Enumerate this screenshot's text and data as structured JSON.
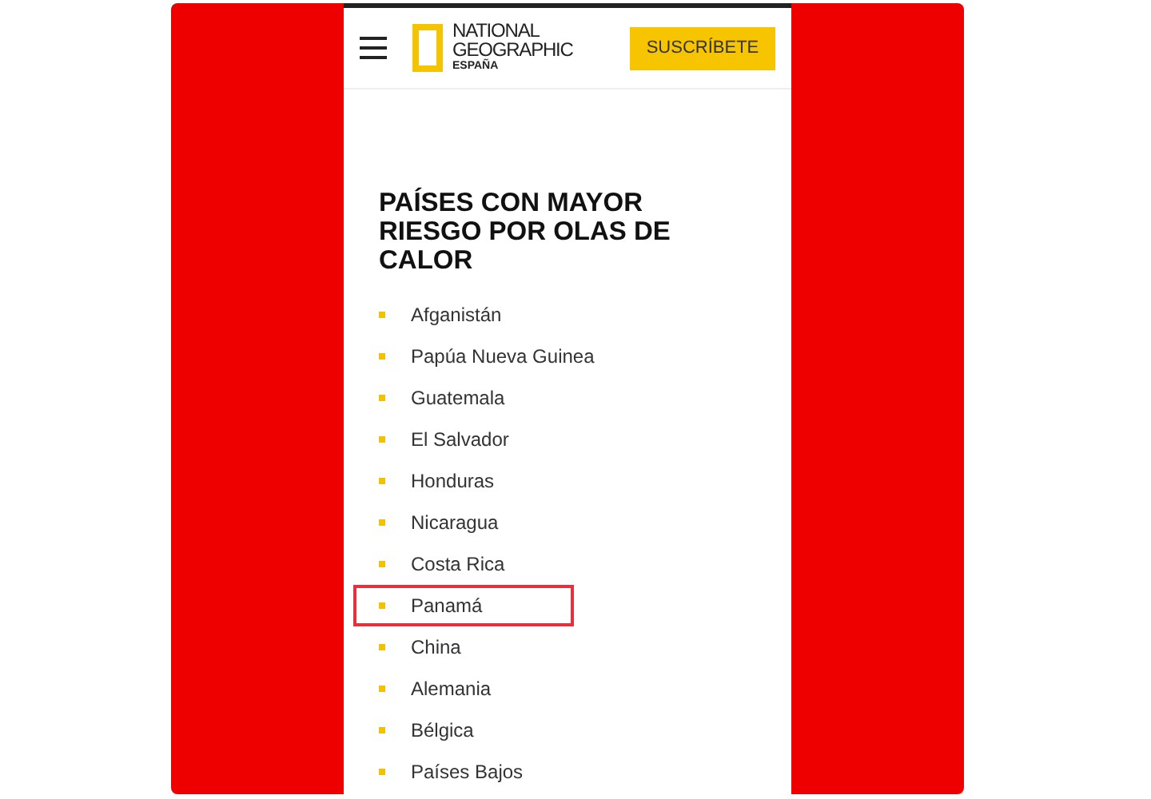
{
  "header": {
    "logo_lines": [
      "NATIONAL",
      "GEOGRAPHIC",
      "ESPAÑA"
    ],
    "subscribe_button": "SUSCRÍBETE"
  },
  "article": {
    "heading": "PAÍSES CON MAYOR RIESGO POR OLAS DE CALOR",
    "countries": [
      {
        "name": "Afganistán",
        "highlighted": false
      },
      {
        "name": "Papúa Nueva Guinea",
        "highlighted": false
      },
      {
        "name": "Guatemala",
        "highlighted": false
      },
      {
        "name": "El Salvador",
        "highlighted": false
      },
      {
        "name": "Honduras",
        "highlighted": false
      },
      {
        "name": "Nicaragua",
        "highlighted": false
      },
      {
        "name": "Costa Rica",
        "highlighted": false
      },
      {
        "name": "Panamá",
        "highlighted": true
      },
      {
        "name": "China",
        "highlighted": false
      },
      {
        "name": "Alemania",
        "highlighted": false
      },
      {
        "name": "Bélgica",
        "highlighted": false
      },
      {
        "name": "Países Bajos",
        "highlighted": false
      }
    ]
  }
}
